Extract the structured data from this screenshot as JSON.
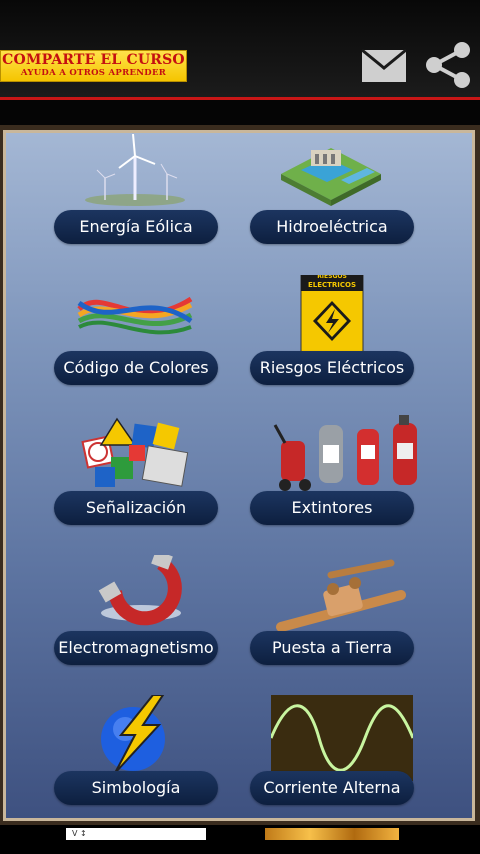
{
  "header": {
    "share_banner_title": "COMPARTE EL CURSO",
    "share_banner_subtitle": "AYUDA A OTROS APRENDER",
    "mail_icon": "mail-icon",
    "share_icon": "share-icon",
    "accent_color": "#c81616"
  },
  "menu": {
    "items": [
      {
        "label": "Energía Eólica",
        "icon": "wind-turbine-icon"
      },
      {
        "label": "Hidroeléctrica",
        "icon": "hydroelectric-dam-icon"
      },
      {
        "label": "Código de Colores",
        "icon": "colored-wires-icon"
      },
      {
        "label": "Riesgos Eléctricos",
        "icon": "electrical-hazard-sign-icon"
      },
      {
        "label": "Señalización",
        "icon": "safety-signs-icon"
      },
      {
        "label": "Extintores",
        "icon": "fire-extinguishers-icon"
      },
      {
        "label": "Electromagnetismo",
        "icon": "magnet-icon"
      },
      {
        "label": "Puesta a Tierra",
        "icon": "grounding-clamp-icon"
      },
      {
        "label": "Simbología",
        "icon": "lightning-globe-icon"
      },
      {
        "label": "Corriente Alterna",
        "icon": "sine-wave-icon"
      }
    ],
    "sign_label": "RIESGOS ELECTRICOS"
  },
  "ad_strip": {
    "left_text": "V ↕"
  }
}
